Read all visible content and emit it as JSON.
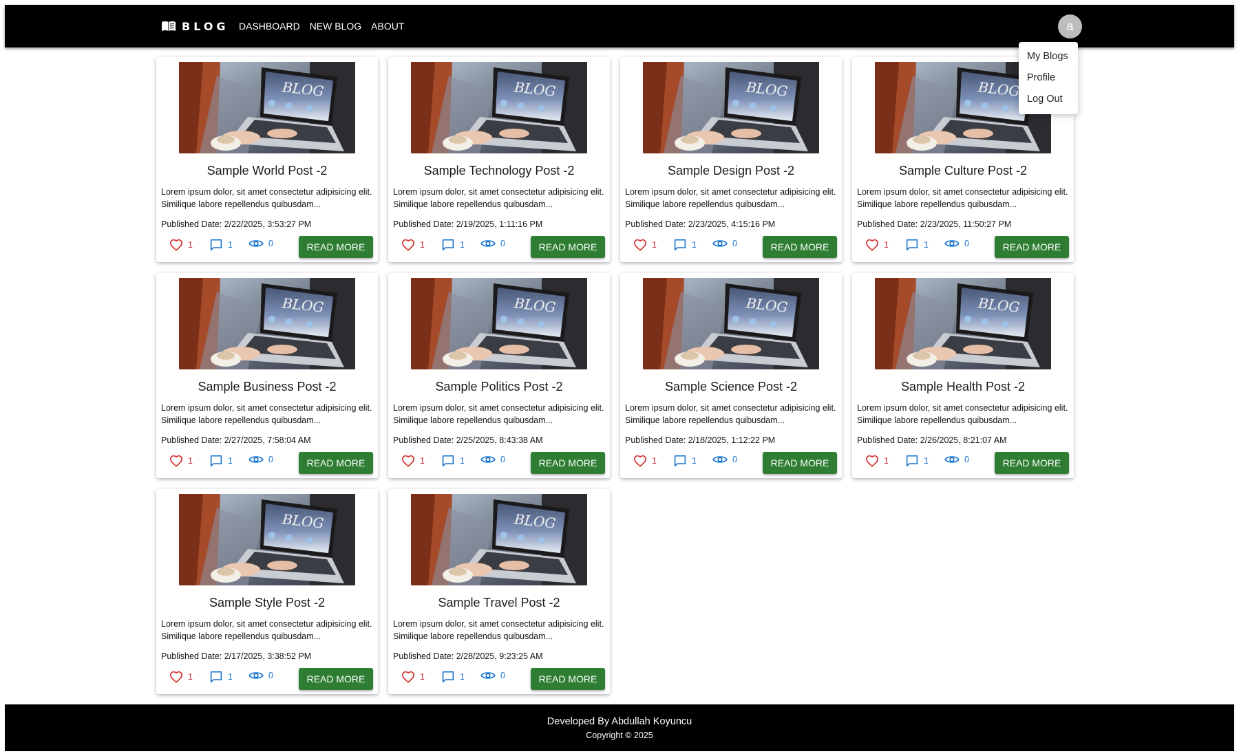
{
  "navbar": {
    "brand": "BLOG",
    "links": [
      "DASHBOARD",
      "NEW BLOG",
      "ABOUT"
    ],
    "avatar_initial": "a"
  },
  "user_menu": {
    "items": [
      "My Blogs",
      "Profile",
      "Log Out"
    ]
  },
  "posts": [
    {
      "title": "Sample World Post -2",
      "excerpt": "Lorem ipsum dolor, sit amet consectetur adipisicing elit. Similique labore repellendus quibusdam...",
      "date": "Published Date: 2/22/2025, 3:53:27 PM",
      "likes": "1",
      "comments": "1",
      "views": "0",
      "button": "READ MORE"
    },
    {
      "title": "Sample Technology Post -2",
      "excerpt": "Lorem ipsum dolor, sit amet consectetur adipisicing elit. Similique labore repellendus quibusdam...",
      "date": "Published Date: 2/19/2025, 1:11:16 PM",
      "likes": "1",
      "comments": "1",
      "views": "0",
      "button": "READ MORE"
    },
    {
      "title": "Sample Design Post -2",
      "excerpt": "Lorem ipsum dolor, sit amet consectetur adipisicing elit. Similique labore repellendus quibusdam...",
      "date": "Published Date: 2/23/2025, 4:15:16 PM",
      "likes": "1",
      "comments": "1",
      "views": "0",
      "button": "READ MORE"
    },
    {
      "title": "Sample Culture Post -2",
      "excerpt": "Lorem ipsum dolor, sit amet consectetur adipisicing elit. Similique labore repellendus quibusdam...",
      "date": "Published Date: 2/23/2025, 11:50:27 PM",
      "likes": "1",
      "comments": "1",
      "views": "0",
      "button": "READ MORE"
    },
    {
      "title": "Sample Business Post -2",
      "excerpt": "Lorem ipsum dolor, sit amet consectetur adipisicing elit. Similique labore repellendus quibusdam...",
      "date": "Published Date: 2/27/2025, 7:58:04 AM",
      "likes": "1",
      "comments": "1",
      "views": "0",
      "button": "READ MORE"
    },
    {
      "title": "Sample Politics Post -2",
      "excerpt": "Lorem ipsum dolor, sit amet consectetur adipisicing elit. Similique labore repellendus quibusdam...",
      "date": "Published Date: 2/25/2025, 8:43:38 AM",
      "likes": "1",
      "comments": "1",
      "views": "0",
      "button": "READ MORE"
    },
    {
      "title": "Sample Science Post -2",
      "excerpt": "Lorem ipsum dolor, sit amet consectetur adipisicing elit. Similique labore repellendus quibusdam...",
      "date": "Published Date: 2/18/2025, 1:12:22 PM",
      "likes": "1",
      "comments": "1",
      "views": "0",
      "button": "READ MORE"
    },
    {
      "title": "Sample Health Post -2",
      "excerpt": "Lorem ipsum dolor, sit amet consectetur adipisicing elit. Similique labore repellendus quibusdam...",
      "date": "Published Date: 2/26/2025, 8:21:07 AM",
      "likes": "1",
      "comments": "1",
      "views": "0",
      "button": "READ MORE"
    },
    {
      "title": "Sample Style Post -2",
      "excerpt": "Lorem ipsum dolor, sit amet consectetur adipisicing elit. Similique labore repellendus quibusdam...",
      "date": "Published Date: 2/17/2025, 3:38:52 PM",
      "likes": "1",
      "comments": "1",
      "views": "0",
      "button": "READ MORE"
    },
    {
      "title": "Sample Travel Post -2",
      "excerpt": "Lorem ipsum dolor, sit amet consectetur adipisicing elit. Similique labore repellendus quibusdam...",
      "date": "Published Date: 2/28/2025, 9:23:25 AM",
      "likes": "1",
      "comments": "1",
      "views": "0",
      "button": "READ MORE"
    }
  ],
  "footer": {
    "developed_by": "Developed By Abdullah Koyuncu",
    "copyright": "Copyright © 2025"
  },
  "colors": {
    "navbar_bg": "#000000",
    "button_green": "#2e7d32",
    "like_red": "#d32f2f",
    "icon_blue": "#1976d2",
    "avatar_gray": "#bdbdbd"
  },
  "icons": {
    "brand": "open-book-icon",
    "likes": "heart-icon",
    "comments": "comment-icon",
    "views": "eye-icon",
    "thumbnail": "laptop-blog-image"
  }
}
